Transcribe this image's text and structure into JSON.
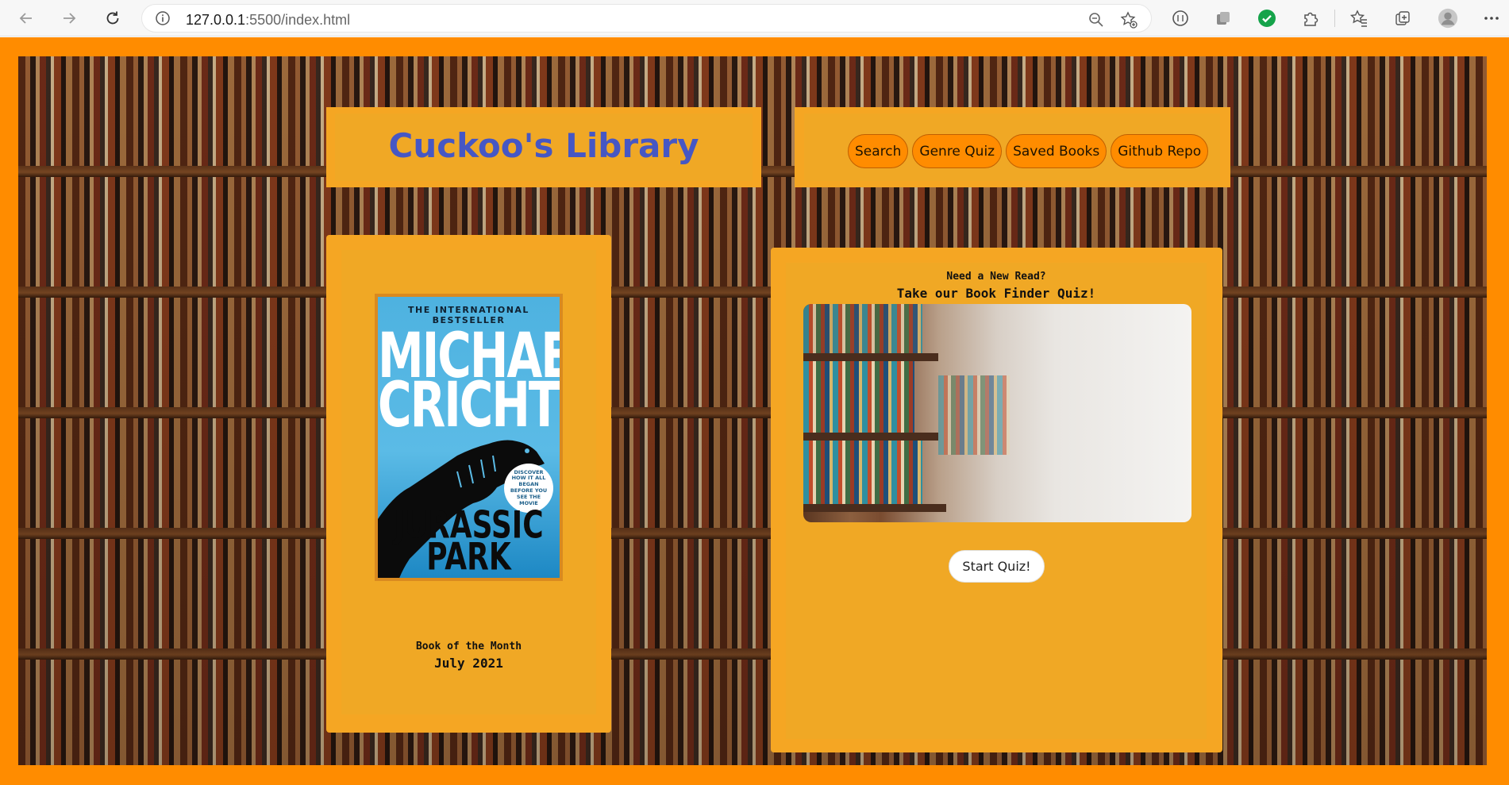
{
  "browser": {
    "url_host": "127.0.0.1",
    "url_rest": ":5500/index.html",
    "icons": [
      "back-icon",
      "forward-icon",
      "refresh-icon",
      "info-icon",
      "zoom-icon",
      "favorite-add-icon",
      "tracking-icon",
      "collections-icon",
      "grammarly-icon",
      "extensions-icon",
      "favorites-icon",
      "collections-add-icon",
      "profile-icon",
      "more-icon"
    ]
  },
  "header": {
    "title": "Cuckoo's Library"
  },
  "nav": {
    "links": [
      "Search",
      "Genre Quiz",
      "Saved Books",
      "Github Repo"
    ]
  },
  "book_of_month": {
    "cover": {
      "tagline": "THE INTERNATIONAL BESTSELLER",
      "author_line1": "MICHAEL",
      "author_line2": "CRICHTON",
      "title_line1": "JURASSIC",
      "title_line2": "PARK",
      "badge": "DISCOVER HOW IT ALL BEGAN BEFORE YOU SEE THE MOVIE"
    },
    "label": "Book of the Month",
    "date": "July 2021"
  },
  "quiz": {
    "kicker": "Need a New Read?",
    "heading": "Take our Book Finder Quiz!",
    "button": "Start Quiz!"
  },
  "colors": {
    "page_border": "#ff8c00",
    "panel": "#f5a623",
    "title_text": "#4657c4",
    "nav_button": "#ff8c00"
  }
}
